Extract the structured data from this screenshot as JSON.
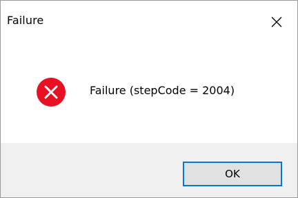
{
  "window": {
    "title": "Failure",
    "close_icon": "close-icon"
  },
  "message": {
    "icon": "error-icon",
    "text": "Failure (stepCode = 2004)"
  },
  "buttons": {
    "ok_label": "OK"
  },
  "colors": {
    "error_red": "#e81123",
    "accent": "#0078d7",
    "footer_bg": "#f0f0f0",
    "button_bg": "#e1e1e1"
  }
}
